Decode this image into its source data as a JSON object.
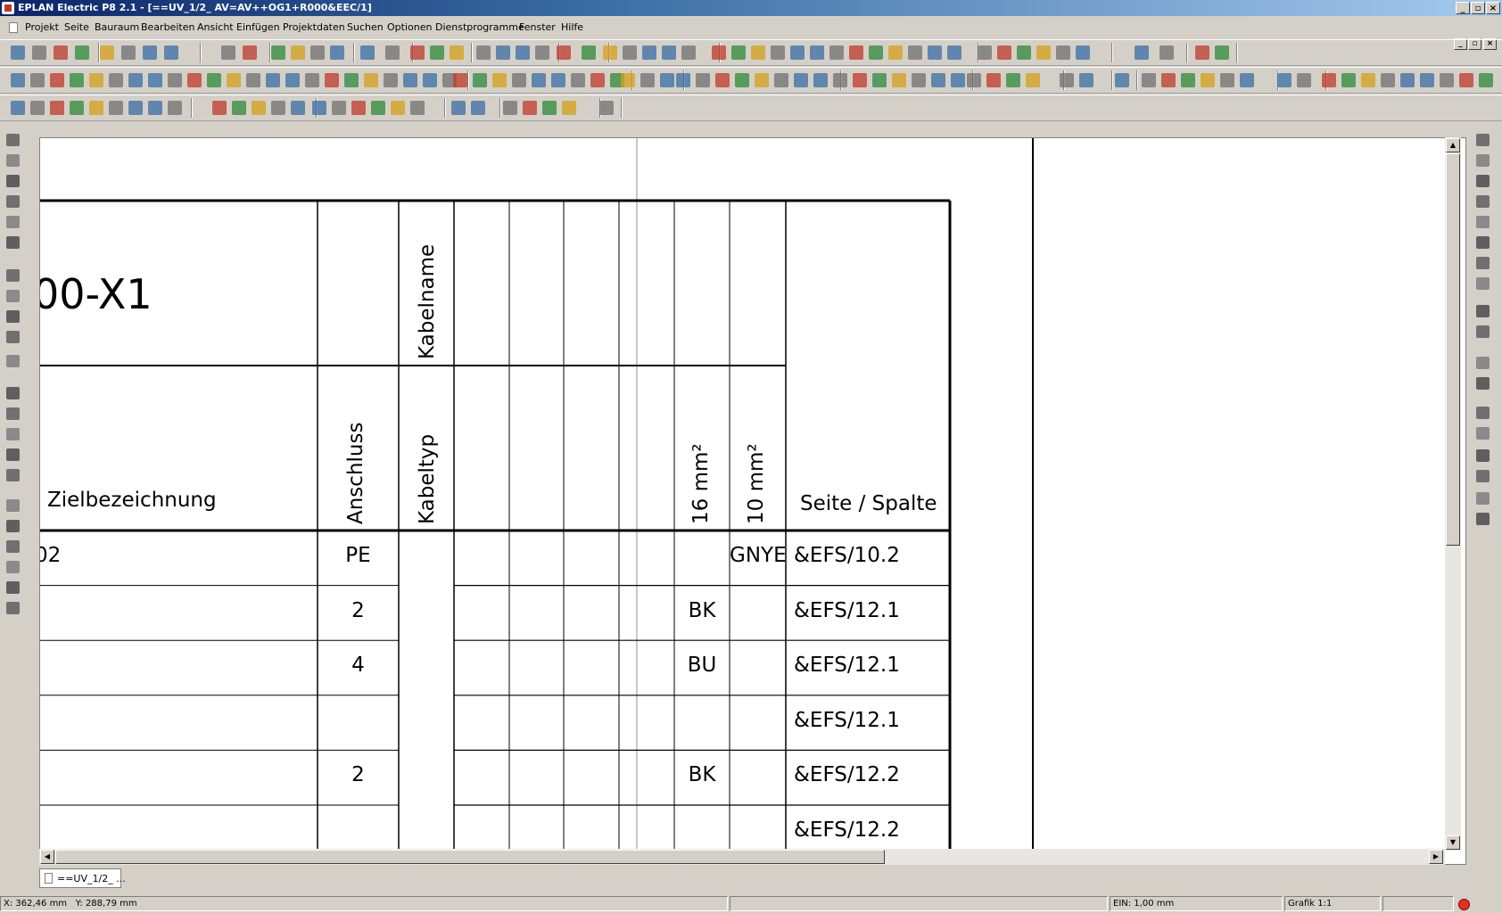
{
  "window": {
    "title": "EPLAN Electric P8 2.1 - [==UV_1/2_ AV=AV++OG1+R000&EEC/1]",
    "minimize_label": "_",
    "restore_label": "▫",
    "close_label": "×"
  },
  "menu": {
    "items": [
      "Projekt",
      "Seite",
      "Bauraum",
      "Bearbeiten",
      "Ansicht",
      "Einfügen",
      "Projektdaten",
      "Suchen",
      "Optionen",
      "Dienstprogramme",
      "Fenster",
      "Hilfe"
    ]
  },
  "drawing": {
    "title": "00-X1",
    "headers": {
      "zielbezeichnung": "Zielbezeichnung",
      "anschluss": "Anschluss",
      "kabelname": "Kabelname",
      "kabeltyp": "Kabeltyp",
      "mm16": "16 mm²",
      "mm10": "10 mm²",
      "seite": "Seite / Spalte"
    },
    "rows": [
      {
        "ziel": "02",
        "anschluss": "PE",
        "mm16": "",
        "mm10": "GNYE",
        "seite": "&EFS/10.2"
      },
      {
        "ziel": "",
        "anschluss": "2",
        "mm16": "BK",
        "mm10": "",
        "seite": "&EFS/12.1"
      },
      {
        "ziel": "",
        "anschluss": "4",
        "mm16": "BU",
        "mm10": "",
        "seite": "&EFS/12.1"
      },
      {
        "ziel": "",
        "anschluss": "",
        "mm16": "",
        "mm10": "",
        "seite": "&EFS/12.1"
      },
      {
        "ziel": "",
        "anschluss": "2",
        "mm16": "BK",
        "mm10": "",
        "seite": "&EFS/12.2"
      },
      {
        "ziel": "",
        "anschluss": "",
        "mm16": "",
        "mm10": "",
        "seite": "&EFS/12.2"
      }
    ]
  },
  "tab": {
    "label": "==UV_1/2_ ..."
  },
  "status": {
    "x": "X: 362,46 mm",
    "y": "Y: 288,79 mm",
    "ein": "EIN: 1,00 mm",
    "grafik": "Grafik 1:1"
  },
  "colors": {
    "chrome": "#d4d0c8",
    "title_start": "#0a246a",
    "title_end": "#a6caf0",
    "icon_blue": "#3a6ea5",
    "icon_red": "#c0392b",
    "icon_green": "#2e8b3a",
    "icon_yellow": "#d4a017",
    "icon_gray": "#707070"
  }
}
